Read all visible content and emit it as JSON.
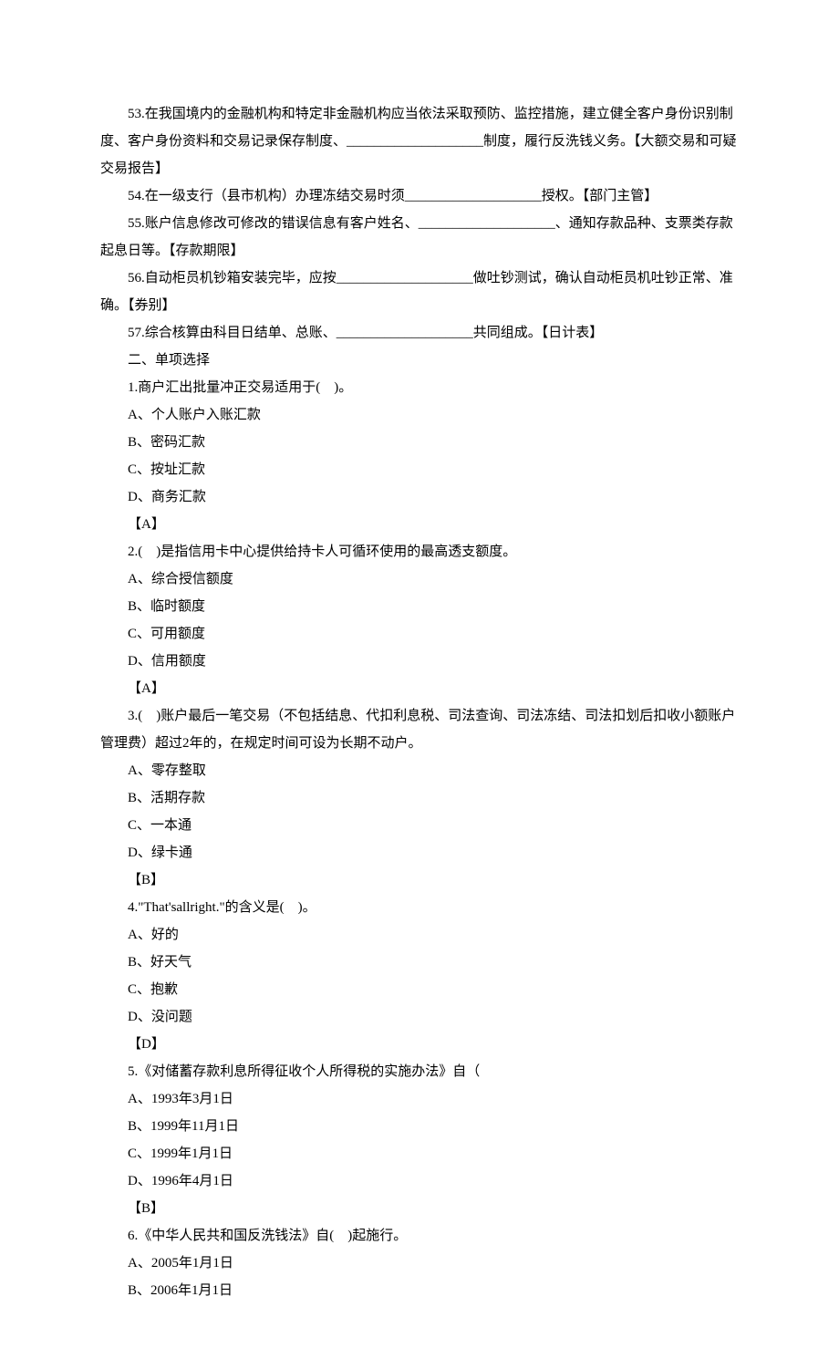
{
  "fillBlanks": [
    {
      "num": "53",
      "text": "在我国境内的金融机构和特定非金融机构应当依法采取预防、监控措施，建立健全客户身份识别制度、客户身份资料和交易记录保存制度、____________________制度，履行反洗钱义务。【大额交易和可疑交易报告】"
    },
    {
      "num": "54",
      "text": "在一级支行（县市机构）办理冻结交易时须____________________授权。【部门主管】"
    },
    {
      "num": "55",
      "text": "账户信息修改可修改的错误信息有客户姓名、____________________、通知存款品种、支票类存款起息日等。【存款期限】"
    },
    {
      "num": "56",
      "text": "自动柜员机钞箱安装完毕，应按____________________做吐钞测试，确认自动柜员机吐钞正常、准确。【券别】"
    },
    {
      "num": "57",
      "text": "综合核算由科目日结单、总账、____________________共同组成。【日计表】"
    }
  ],
  "section2": "二、单项选择",
  "questions": [
    {
      "num": "1",
      "stem": "商户汇出批量冲正交易适用于(　)。",
      "opts": [
        "A、个人账户入账汇款",
        "B、密码汇款",
        "C、按址汇款",
        "D、商务汇款"
      ],
      "ans": "【A】"
    },
    {
      "num": "2",
      "stem": "(　)是指信用卡中心提供给持卡人可循环使用的最高透支额度。",
      "opts": [
        "A、综合授信额度",
        "B、临时额度",
        "C、可用额度",
        "D、信用额度"
      ],
      "ans": "【A】"
    },
    {
      "num": "3",
      "stem": "(　)账户最后一笔交易（不包括结息、代扣利息税、司法查询、司法冻结、司法扣划后扣收小额账户管理费）超过2年的，在规定时间可设为长期不动户。",
      "opts": [
        "A、零存整取",
        "B、活期存款",
        "C、一本通",
        "D、绿卡通"
      ],
      "ans": "【B】"
    },
    {
      "num": "4",
      "stem": "\"That'sallright.\"的含义是(　)。",
      "opts": [
        "A、好的",
        "B、好天气",
        "C、抱歉",
        "D、没问题"
      ],
      "ans": "【D】"
    },
    {
      "num": "5",
      "stem": "《对储蓄存款利息所得征收个人所得税的实施办法》自（",
      "opts": [
        "A、1993年3月1日",
        "B、1999年11月1日",
        "C、1999年1月1日",
        "D、1996年4月1日"
      ],
      "ans": "【B】"
    },
    {
      "num": "6",
      "stem": "《中华人民共和国反洗钱法》自(　)起施行。",
      "opts": [
        "A、2005年1月1日",
        "B、2006年1月1日"
      ],
      "ans": ""
    }
  ]
}
